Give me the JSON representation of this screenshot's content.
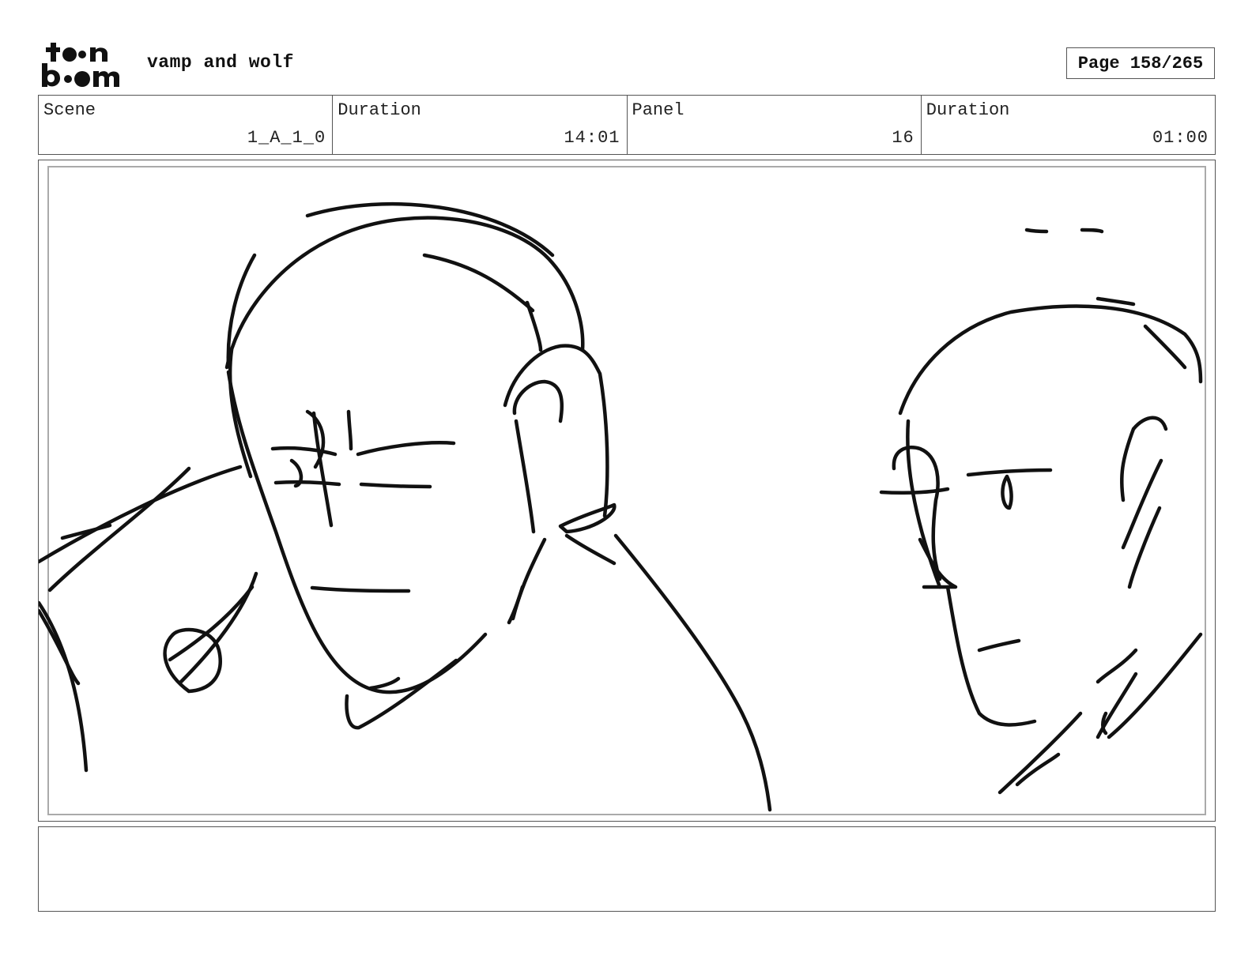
{
  "header": {
    "logo_text": "toon boom",
    "project_title": "vamp and wolf",
    "page_label": "Page 158/265"
  },
  "info": {
    "scene_label": "Scene",
    "scene_value": "1_A_1_0",
    "scene_duration_label": "Duration",
    "scene_duration_value": "14:01",
    "panel_label": "Panel",
    "panel_value": "16",
    "panel_duration_label": "Duration",
    "panel_duration_value": "01:00"
  },
  "panel": {
    "image": "sketch-drawing"
  },
  "notes": {
    "text": ""
  }
}
